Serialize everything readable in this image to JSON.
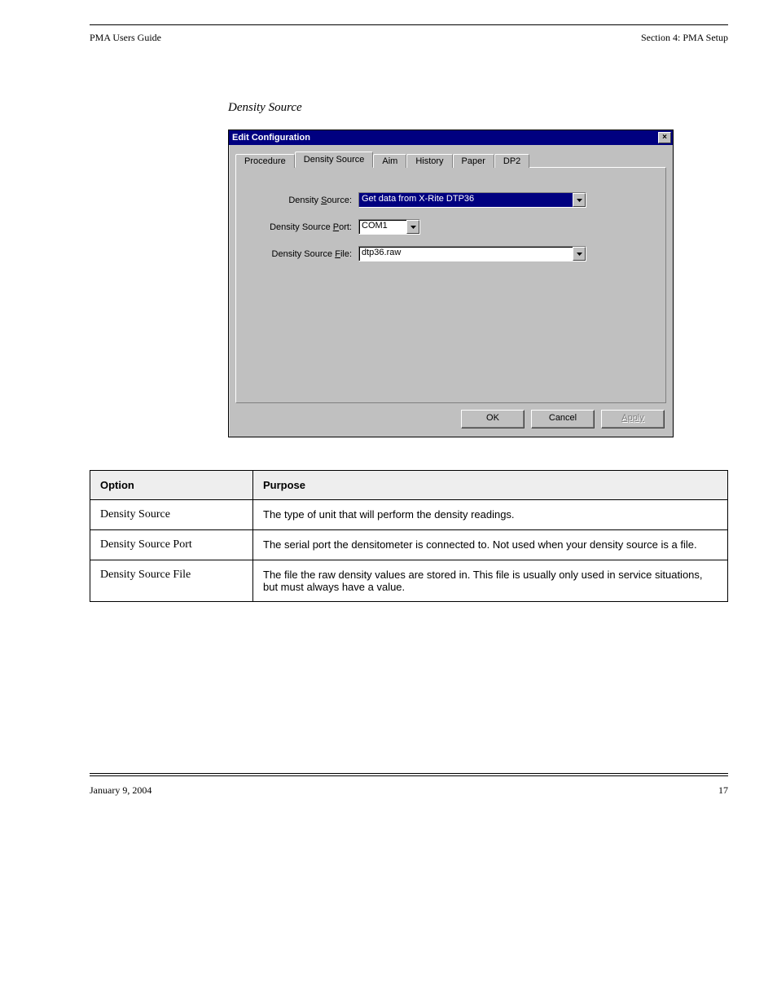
{
  "running_head": {
    "left": "PMA Users Guide",
    "right": "Section 4: PMA Setup"
  },
  "section_title": "Density Source",
  "dialog": {
    "title": "Edit Configuration",
    "tabs": [
      "Procedure",
      "Density Source",
      "Aim",
      "History",
      "Paper",
      "DP2"
    ],
    "active_tab_index": 1,
    "fields": {
      "density_source_label": "Density Source:",
      "density_source_value": "Get data from X-Rite DTP36",
      "density_port_label": "Density Source Port:",
      "density_port_value": "COM1",
      "density_file_label": "Density Source File:",
      "density_file_value": "dtp36.raw"
    },
    "buttons": {
      "ok": "OK",
      "cancel": "Cancel",
      "apply": "Apply"
    }
  },
  "table": {
    "head": [
      "Option",
      "Purpose"
    ],
    "rows": [
      {
        "opt": "Density Source",
        "purpose": "The type of unit that will perform the density readings."
      },
      {
        "opt": "Density Source Port",
        "purpose": "The serial port the densitometer is connected to. Not used when your density source is a file."
      },
      {
        "opt": "Density Source File",
        "purpose": "The file the raw density values are stored in. This file is usually only used in service situations, but must always have a value."
      }
    ]
  },
  "footer": {
    "left": "January 9, 2004",
    "right": "17"
  }
}
